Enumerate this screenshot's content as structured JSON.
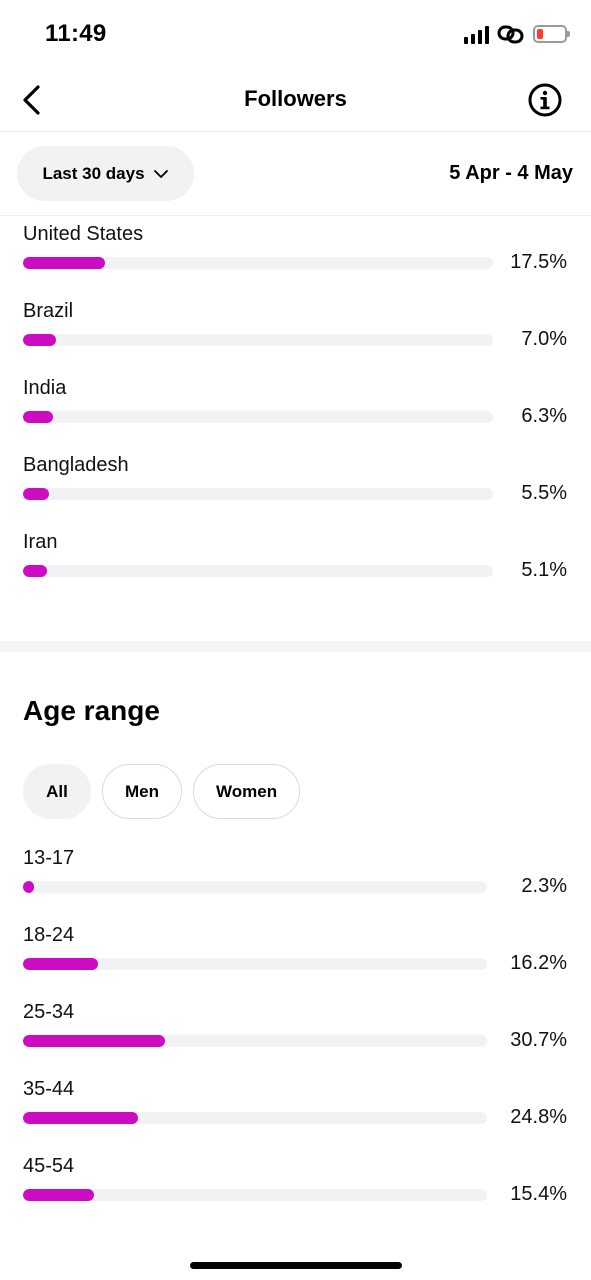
{
  "status_bar": {
    "time": "11:49",
    "battery_color": "#ff3b30"
  },
  "header": {
    "title": "Followers",
    "back_icon": "chevron-left-icon",
    "info_icon": "info-circle-icon"
  },
  "filter": {
    "range_label": "Last 30 days",
    "date_range": "5 Apr - 4 May"
  },
  "accent_color": "#cc0cc3",
  "countries": [
    {
      "label": "United States",
      "value": "17.5%",
      "fraction": 0.175
    },
    {
      "label": "Brazil",
      "value": "7.0%",
      "fraction": 0.07
    },
    {
      "label": "India",
      "value": "6.3%",
      "fraction": 0.063
    },
    {
      "label": "Bangladesh",
      "value": "5.5%",
      "fraction": 0.055
    },
    {
      "label": "Iran",
      "value": "5.1%",
      "fraction": 0.051
    }
  ],
  "age_section": {
    "title": "Age range",
    "chips": [
      "All",
      "Men",
      "Women"
    ],
    "selected_chip": "All",
    "items": [
      {
        "label": "13-17",
        "value": "2.3%",
        "fraction": 0.023
      },
      {
        "label": "18-24",
        "value": "16.2%",
        "fraction": 0.162
      },
      {
        "label": "25-34",
        "value": "30.7%",
        "fraction": 0.307
      },
      {
        "label": "35-44",
        "value": "24.8%",
        "fraction": 0.248
      },
      {
        "label": "45-54",
        "value": "15.4%",
        "fraction": 0.154
      }
    ]
  }
}
